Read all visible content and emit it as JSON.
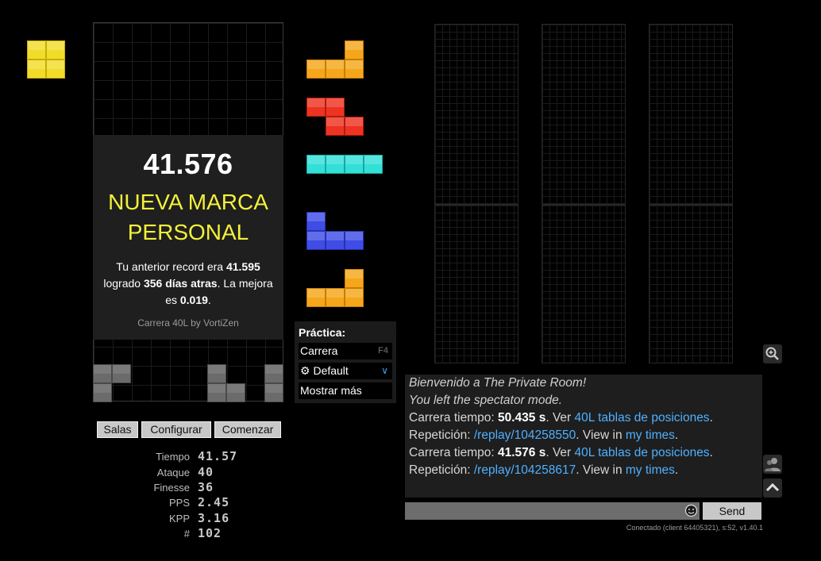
{
  "hold_piece": "O",
  "result": {
    "score": "41.576",
    "headline": "NUEVA MARCA PERSONAL",
    "prev_text_1": "Tu anterior record era ",
    "prev_value": "41.595",
    "prev_text_2": "logrado ",
    "days_ago": "356 días atras",
    "prev_text_3": ". La mejora es ",
    "improvement": "0.019",
    "prev_text_4": ".",
    "race_credit": "Carrera 40L by VortiZen"
  },
  "next_queue": [
    "L",
    "Z",
    "I",
    "J",
    "L"
  ],
  "buttons": {
    "rooms": "Salas",
    "settings": "Configurar",
    "start": "Comenzar"
  },
  "stats": [
    {
      "label": "Tiempo",
      "value": "41.57"
    },
    {
      "label": "Ataque",
      "value": "40"
    },
    {
      "label": "Finesse",
      "value": "36"
    },
    {
      "label": "PPS",
      "value": "2.45"
    },
    {
      "label": "KPP",
      "value": "3.16"
    },
    {
      "label": "#",
      "value": "102"
    }
  ],
  "practice": {
    "title": "Práctica:",
    "mode": "Carrera",
    "mode_key": "F4",
    "preset": "Default",
    "more": "Mostrar más"
  },
  "chat": {
    "welcome": "Bienvenido a The Private Room!",
    "left_spectator": "You left the spectator mode.",
    "race_time_label": "Carrera tiempo: ",
    "race1_time": "50.435 s",
    "see_text": ". Ver ",
    "leaderboard_link": "40L tablas de posiciones",
    "period": ".",
    "replay_label": "Repetición: ",
    "replay1": "/replay/104258550",
    "view_in": ". View in ",
    "my_times": "my times",
    "race2_time": "41.576 s",
    "replay2": "/replay/104258617"
  },
  "send_label": "Send",
  "connection_status": "Conectado (client 64405321), s:52, v1.40.1",
  "colors": {
    "accent_link": "#4fb0ff",
    "headline": "#f4f03a"
  }
}
